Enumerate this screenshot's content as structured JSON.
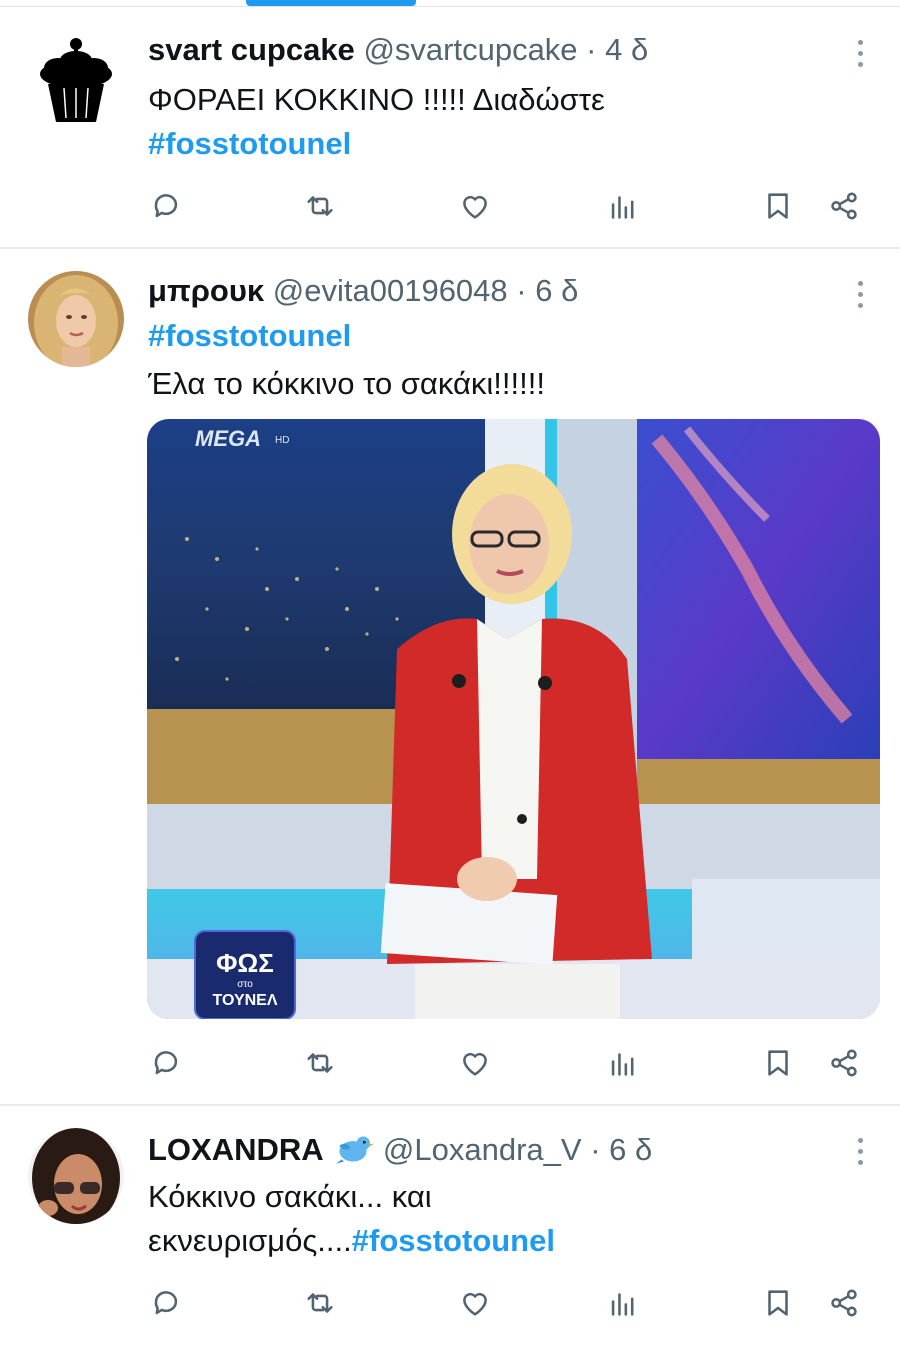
{
  "tweets": [
    {
      "name": "svart cupcake",
      "handle": "@svartcupcake",
      "separator": "·",
      "time": "4 δ",
      "lines": [
        "ΦΟΡΑΕΙ ΚΟΚΚΙΝΟ !!!!! Διαδώστε"
      ],
      "hashtag": "#fosstotounel",
      "avatar_icon": "cupcake-icon"
    },
    {
      "name": "μπρουκ",
      "handle": "@evita00196048",
      "separator": "·",
      "time": "6 δ",
      "hashtag": "#fosstotounel",
      "lines": [
        "Έλα το κόκκινο το σακάκι!!!!!!"
      ],
      "media": {
        "channel_logo": "MEGA",
        "channel_suffix": "HD",
        "show_logo_line1": "ΦΩΣ",
        "show_logo_line2": "στο",
        "show_logo_line3": "ΤΟΥΝΕΛ"
      }
    },
    {
      "name": "LOXANDRA",
      "handle": "@Loxandra_V",
      "separator": "·",
      "time": "6 δ",
      "lines": [
        "Κόκκινο σακάκι... και"
      ],
      "line2_text": "εκνευρισμός....",
      "hashtag": "#fosstotounel",
      "badge_icon": "bird-emoji-icon"
    }
  ],
  "actions": [
    "reply-icon",
    "retweet-icon",
    "like-icon",
    "views-icon",
    "bookmark-icon",
    "share-icon"
  ],
  "colors": {
    "accent": "#1d9bf0",
    "text": "#0f1419",
    "secondary": "#536471"
  }
}
